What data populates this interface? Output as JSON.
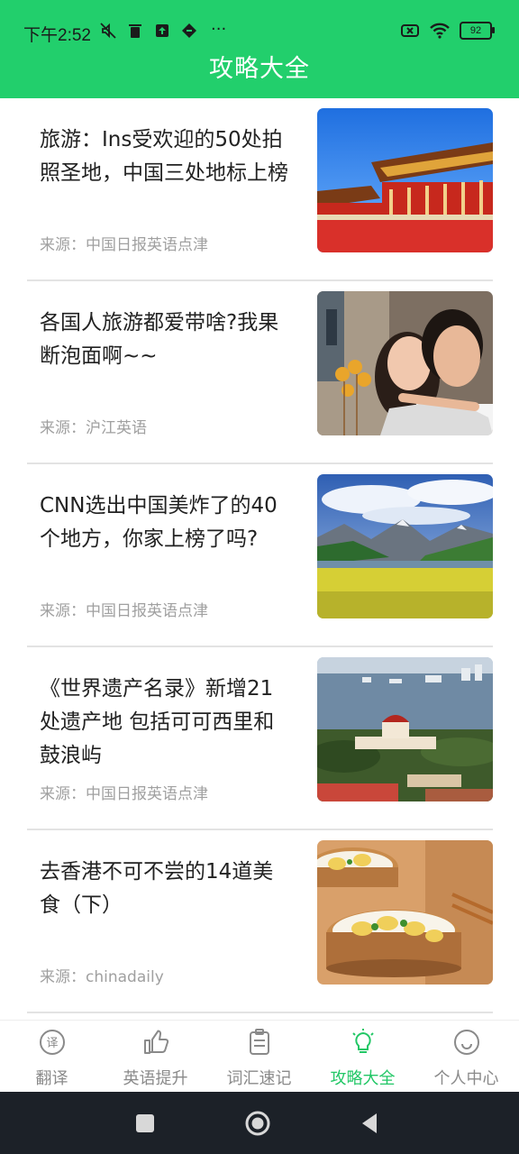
{
  "status": {
    "time": "下午2:52",
    "ellipsis": "···",
    "battery": "92"
  },
  "header": {
    "title": "攻略大全"
  },
  "articles": [
    {
      "title": "旅游：Ins受欢迎的50处拍照圣地，中国三处地标上榜",
      "source": "来源：中国日报英语点津",
      "image": "forbidden-city"
    },
    {
      "title": "各国人旅游都爱带啥?我果断泡面啊~~",
      "source": "来源：沪江英语",
      "image": "couple-travel"
    },
    {
      "title": "CNN选出中国美炸了的40个地方，你家上榜了吗?",
      "source": "来源：中国日报英语点津",
      "image": "mountain-meadow"
    },
    {
      "title": "《世界遗产名录》新增21处遗产地 包括可可西里和鼓浪屿",
      "source": "来源：中国日报英语点津",
      "image": "gulangyu-island"
    },
    {
      "title": "去香港不可不尝的14道美食（下）",
      "source": "来源：chinadaily",
      "image": "steamed-dishes"
    }
  ],
  "tabs": [
    {
      "label": "翻译",
      "icon": "translate-icon",
      "active": false
    },
    {
      "label": "英语提升",
      "icon": "thumbs-up-icon",
      "active": false
    },
    {
      "label": "词汇速记",
      "icon": "clipboard-icon",
      "active": false
    },
    {
      "label": "攻略大全",
      "icon": "lightbulb-icon",
      "active": true
    },
    {
      "label": "个人中心",
      "icon": "smiley-icon",
      "active": false
    }
  ],
  "colors": {
    "accent": "#22cf6c",
    "active_tab": "#22c766",
    "inactive_tab": "#8a8a8a"
  }
}
